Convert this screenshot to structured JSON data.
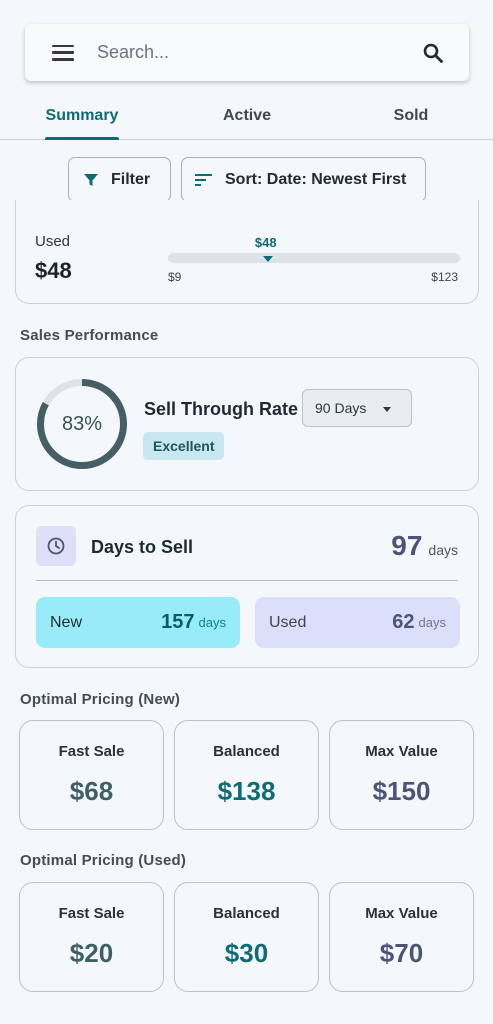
{
  "search": {
    "placeholder": "Search..."
  },
  "tabs": [
    {
      "label": "Summary",
      "active": true
    },
    {
      "label": "Active",
      "active": false
    },
    {
      "label": "Sold",
      "active": false
    }
  ],
  "toolbar": {
    "filter_label": "Filter",
    "sort_label": "Sort: Date: Newest First"
  },
  "price_range": {
    "condition_label": "Used",
    "current_value": "$48",
    "marker_label": "$48",
    "min_label": "$9",
    "max_label": "$123",
    "min": 9,
    "max": 123,
    "current": 48
  },
  "sales_performance": {
    "section_title": "Sales Performance",
    "sell_through": {
      "percent_label": "83%",
      "percent": 83,
      "title": "Sell Through Rate",
      "period": "90 Days",
      "rating": "Excellent"
    },
    "days_to_sell": {
      "title": "Days to Sell",
      "total": "97",
      "unit": "days",
      "new": {
        "label": "New",
        "value": "157",
        "unit": "days"
      },
      "used": {
        "label": "Used",
        "value": "62",
        "unit": "days"
      }
    }
  },
  "pricing_new": {
    "section_title": "Optimal Pricing (New)",
    "fast_sale": {
      "label": "Fast Sale",
      "value": "$68"
    },
    "balanced": {
      "label": "Balanced",
      "value": "$138"
    },
    "max_value": {
      "label": "Max Value",
      "value": "$150"
    }
  },
  "pricing_used": {
    "section_title": "Optimal Pricing (Used)",
    "fast_sale": {
      "label": "Fast Sale",
      "value": "$20"
    },
    "balanced": {
      "label": "Balanced",
      "value": "$30"
    },
    "max_value": {
      "label": "Max Value",
      "value": "$70"
    }
  },
  "colors": {
    "accent": "#0e6b78",
    "donut_track": "#dde3e6",
    "donut_fill": "#465e66",
    "new_pill": "#98ecf9",
    "used_pill": "#dcdff9"
  }
}
